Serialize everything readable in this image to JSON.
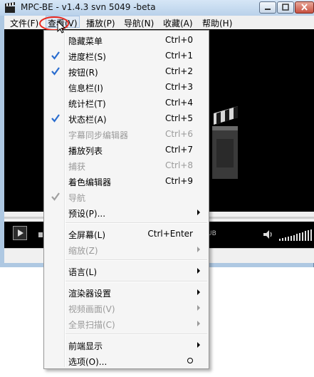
{
  "window": {
    "title": "MPC-BE - v1.4.3 svn 5049 -beta",
    "app_icon": "clapperboard-icon",
    "controls": [
      "minimize-icon",
      "maximize-icon",
      "close-icon"
    ]
  },
  "menubar": {
    "items": [
      {
        "label": "文件(F)"
      },
      {
        "label": "查看(V)",
        "active": true
      },
      {
        "label": "播放(P)"
      },
      {
        "label": "导航(N)"
      },
      {
        "label": "收藏(A)"
      },
      {
        "label": "帮助(H)"
      }
    ]
  },
  "player": {
    "codec_label": "UB"
  },
  "view_menu": {
    "items": [
      {
        "label": "隐藏菜单",
        "shortcut": "Ctrl+0"
      },
      {
        "label": "进度栏(S)",
        "shortcut": "Ctrl+1",
        "checked": true
      },
      {
        "label": "按钮(R)",
        "shortcut": "Ctrl+2",
        "checked": true
      },
      {
        "label": "信息栏(I)",
        "shortcut": "Ctrl+3"
      },
      {
        "label": "统计栏(T)",
        "shortcut": "Ctrl+4"
      },
      {
        "label": "状态栏(A)",
        "shortcut": "Ctrl+5",
        "checked": true
      },
      {
        "label": "字幕同步编辑器",
        "shortcut": "Ctrl+6",
        "disabled": true
      },
      {
        "label": "播放列表",
        "shortcut": "Ctrl+7"
      },
      {
        "label": "捕获",
        "shortcut": "Ctrl+8",
        "disabled": true
      },
      {
        "label": "着色编辑器",
        "shortcut": "Ctrl+9"
      },
      {
        "label": "导航",
        "shortcut": "",
        "disabled": true,
        "checked": true
      },
      {
        "label": "预设(P)...",
        "shortcut": "",
        "submenu": true
      },
      {
        "separator": true
      },
      {
        "label": "全屏幕(L)",
        "shortcut": "Ctrl+Enter"
      },
      {
        "label": "缩放(Z)",
        "shortcut": "",
        "disabled": true,
        "submenu": true
      },
      {
        "separator": true
      },
      {
        "label": "语言(L)",
        "shortcut": "",
        "submenu": true
      },
      {
        "separator": true
      },
      {
        "label": "渲染器设置",
        "shortcut": "",
        "submenu": true
      },
      {
        "label": "视频画面(V)",
        "shortcut": "",
        "disabled": true,
        "submenu": true
      },
      {
        "label": "全景扫描(C)",
        "shortcut": "",
        "disabled": true,
        "submenu": true
      },
      {
        "separator": true
      },
      {
        "label": "前端显示",
        "shortcut": "",
        "submenu": true
      },
      {
        "label": "选项(O)...",
        "shortcut": "",
        "radio": true
      }
    ]
  },
  "colors": {
    "check": "#2a6dcf",
    "annotation": "#e8281e",
    "titlebar": "#bcd3ea"
  }
}
